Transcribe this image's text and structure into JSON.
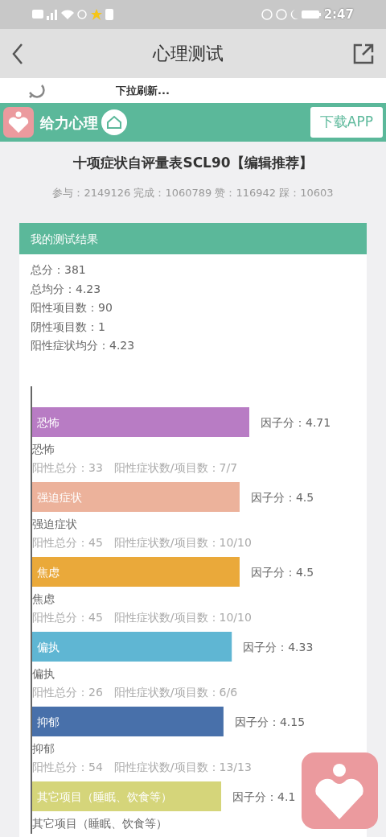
{
  "status_bar": {
    "time": "2:47"
  },
  "nav": {
    "title": "心理测试"
  },
  "pull_refresh": {
    "text": "下拉刷新..."
  },
  "brand": {
    "name": "给力心理",
    "download": "下载APP"
  },
  "test": {
    "title": "十项症状自评量表SCL90【编辑推荐】",
    "stats": "参与：2149126 完成：1060789 赞：116942 踩：10603"
  },
  "result": {
    "header": "我的测试结果",
    "lines": [
      "总分：381",
      "总均分：4.23",
      "阳性项目数：90",
      "阴性项目数：1",
      "阳性症状均分：4.23"
    ],
    "chart_data": {
      "type": "bar",
      "orientation": "horizontal",
      "categories": [
        "恐怖",
        "强迫症状",
        "焦虑",
        "偏执",
        "抑郁",
        "其它项目（睡眠、饮食等）"
      ],
      "values": [
        4.71,
        4.5,
        4.5,
        4.33,
        4.15,
        4.1
      ],
      "value_labels": [
        "因子分：4.71",
        "因子分：4.5",
        "因子分：4.5",
        "因子分：4.33",
        "因子分：4.15",
        "因子分：4.1"
      ]
    },
    "factors": [
      {
        "color": "#b87cc4",
        "caption": "恐怖",
        "detail": "阳性总分：33　阳性症状数/项目数：7/7"
      },
      {
        "color": "#ecb29b",
        "caption": "强迫症状",
        "detail": "阳性总分：45　阳性症状数/项目数：10/10"
      },
      {
        "color": "#eaa93a",
        "caption": "焦虑",
        "detail": "阳性总分：45　阳性症状数/项目数：10/10"
      },
      {
        "color": "#5fb6d3",
        "caption": "偏执",
        "detail": "阳性总分：26　阳性症状数/项目数：6/6"
      },
      {
        "color": "#4870aa",
        "caption": "抑郁",
        "detail": "阳性总分：54　阳性症状数/项目数：13/13"
      },
      {
        "color": "#d5d57a",
        "caption": "其它项目（睡眠、饮食等）"
      }
    ]
  }
}
